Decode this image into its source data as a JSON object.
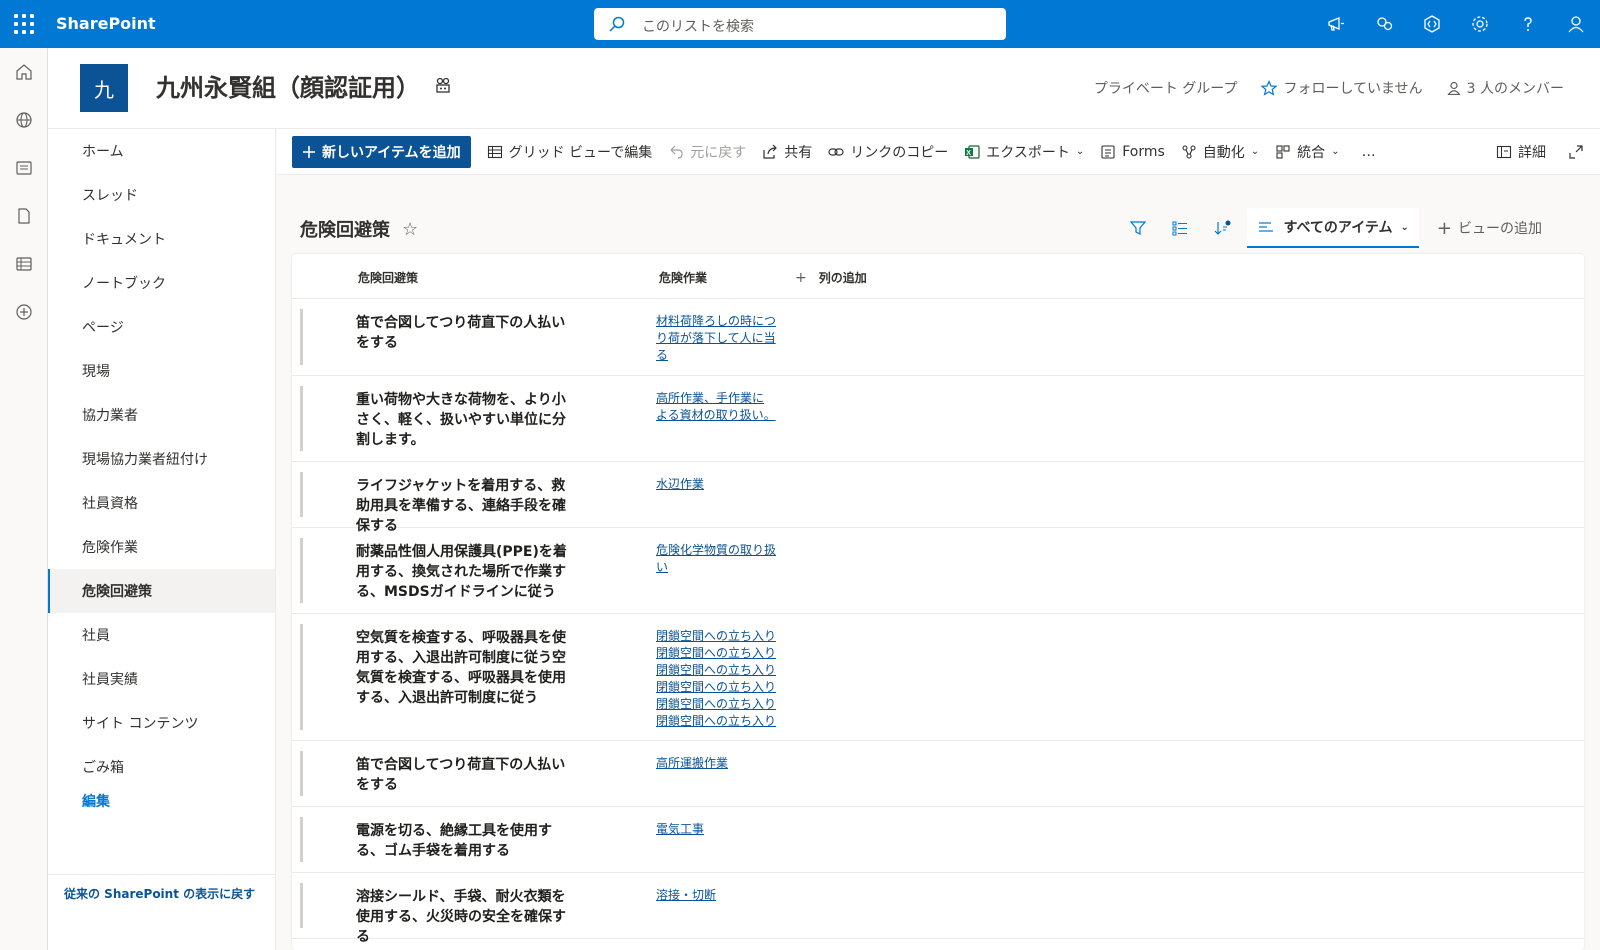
{
  "suite": {
    "brand": "SharePoint",
    "search_placeholder": "このリストを検索"
  },
  "site": {
    "logo_letter": "九",
    "title": "九州永賢組（顔認証用）",
    "private_group": "プライベート グループ",
    "follow": "フォローしていません",
    "members": "3 人のメンバー"
  },
  "nav": {
    "items": [
      "ホーム",
      "スレッド",
      "ドキュメント",
      "ノートブック",
      "ページ",
      "現場",
      "協力業者",
      "現場協力業者紐付け",
      "社員資格",
      "危険作業",
      "危険回避策",
      "社員",
      "社員実績",
      "サイト コンテンツ",
      "ごみ箱"
    ],
    "edit": "編集",
    "footer": "従来の SharePoint の表示に戻す"
  },
  "cmd": {
    "new_item": "新しいアイテムを追加",
    "grid_edit": "グリッド ビューで編集",
    "undo": "元に戻す",
    "share": "共有",
    "copy_link": "リンクのコピー",
    "export": "エクスポート",
    "forms": "Forms",
    "automate": "自動化",
    "integrate": "統合",
    "more": "…",
    "details": "詳細"
  },
  "list": {
    "title": "危険回避策",
    "view_name": "すべてのアイテム",
    "add_view": "ビューの追加",
    "columns": [
      "危険回避策",
      "危険作業",
      "列の追加"
    ],
    "rows": [
      {
        "title": "笛で合図してつり荷直下の人払いをする",
        "links": [
          "材料荷降ろしの時につり荷が落下して人に当る"
        ]
      },
      {
        "title": "重い荷物や大きな荷物を、より小さく、軽く、扱いやすい単位に分割します。",
        "links": [
          "高所作業、手作業による資材の取り扱い。"
        ]
      },
      {
        "title": "ライフジャケットを着用する、救助用具を準備する、連絡手段を確保する",
        "links": [
          "水辺作業"
        ]
      },
      {
        "title": "耐薬品性個人用保護具(PPE)を着用する、換気された場所で作業する、MSDSガイドラインに従う",
        "links": [
          "危険化学物質の取り扱い"
        ]
      },
      {
        "title": "空気質を検査する、呼吸器具を使用する、入退出許可制度に従う空気質を検査する、呼吸器具を使用する、入退出許可制度に従う",
        "links": [
          "閉鎖空間への立ち入り",
          "閉鎖空間への立ち入り",
          "閉鎖空間への立ち入り",
          "閉鎖空間への立ち入り",
          "閉鎖空間への立ち入り",
          "閉鎖空間への立ち入り"
        ]
      },
      {
        "title": "笛で合図してつり荷直下の人払いをする",
        "links": [
          "高所運搬作業"
        ]
      },
      {
        "title": "電源を切る、絶縁工具を使用する、ゴム手袋を着用する",
        "links": [
          "電気工事"
        ]
      },
      {
        "title": "溶接シールド、手袋、耐火衣類を使用する、火災時の安全を確保する",
        "links": [
          "溶接・切断"
        ]
      }
    ]
  },
  "colors": {
    "suite_blue": "#0078d4",
    "primary_button": "#0b5394",
    "link": "#0b5394"
  }
}
